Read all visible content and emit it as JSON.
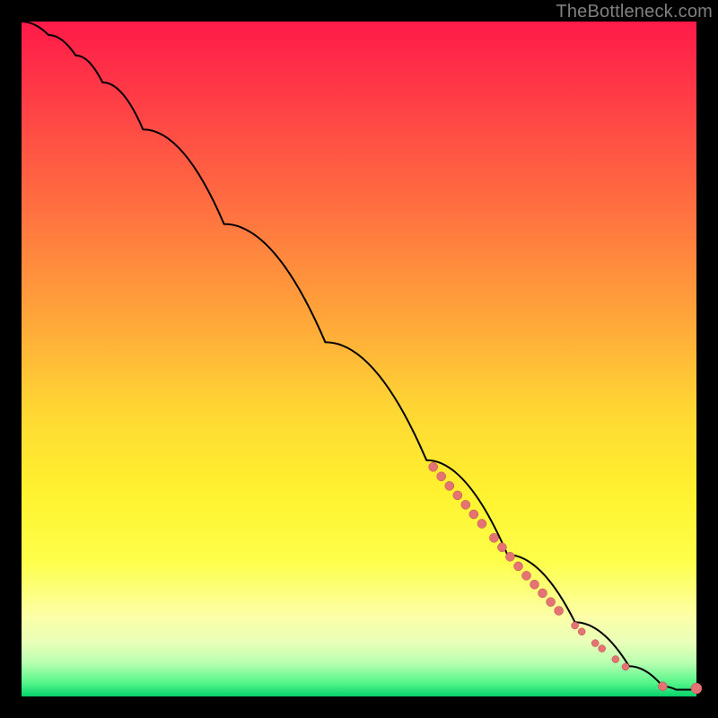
{
  "watermark": "TheBottleneck.com",
  "colors": {
    "marker_fill": "#e57373",
    "marker_stroke": "#bb4a4a",
    "curve_stroke": "#000000"
  },
  "chart_data": {
    "type": "line",
    "title": "",
    "xlabel": "",
    "ylabel": "",
    "xlim": [
      0,
      100
    ],
    "ylim": [
      0,
      100
    ],
    "curve": [
      {
        "x": 0,
        "y": 100
      },
      {
        "x": 4,
        "y": 98
      },
      {
        "x": 8,
        "y": 95
      },
      {
        "x": 12,
        "y": 91
      },
      {
        "x": 18,
        "y": 84
      },
      {
        "x": 30,
        "y": 70
      },
      {
        "x": 45,
        "y": 52.5
      },
      {
        "x": 60,
        "y": 35
      },
      {
        "x": 72,
        "y": 21
      },
      {
        "x": 82,
        "y": 11
      },
      {
        "x": 90,
        "y": 4.5
      },
      {
        "x": 95,
        "y": 1.5
      },
      {
        "x": 97,
        "y": 1.0
      },
      {
        "x": 100,
        "y": 1.0
      }
    ],
    "markers": [
      {
        "x": 61.0,
        "y": 34.0,
        "r": 5
      },
      {
        "x": 62.2,
        "y": 32.6,
        "r": 5
      },
      {
        "x": 63.4,
        "y": 31.2,
        "r": 5
      },
      {
        "x": 64.6,
        "y": 29.8,
        "r": 5
      },
      {
        "x": 65.8,
        "y": 28.4,
        "r": 5
      },
      {
        "x": 67.0,
        "y": 27.0,
        "r": 5
      },
      {
        "x": 68.2,
        "y": 25.6,
        "r": 5
      },
      {
        "x": 70.0,
        "y": 23.5,
        "r": 5
      },
      {
        "x": 71.2,
        "y": 22.1,
        "r": 5
      },
      {
        "x": 72.4,
        "y": 20.7,
        "r": 5
      },
      {
        "x": 73.6,
        "y": 19.3,
        "r": 5
      },
      {
        "x": 74.8,
        "y": 17.9,
        "r": 5
      },
      {
        "x": 76.0,
        "y": 16.6,
        "r": 5
      },
      {
        "x": 77.2,
        "y": 15.3,
        "r": 5
      },
      {
        "x": 78.4,
        "y": 14.0,
        "r": 5
      },
      {
        "x": 79.6,
        "y": 12.7,
        "r": 5
      },
      {
        "x": 82.0,
        "y": 10.5,
        "r": 4
      },
      {
        "x": 83.0,
        "y": 9.6,
        "r": 4
      },
      {
        "x": 85.0,
        "y": 7.9,
        "r": 4
      },
      {
        "x": 86.0,
        "y": 7.1,
        "r": 4
      },
      {
        "x": 88.0,
        "y": 5.5,
        "r": 4
      },
      {
        "x": 89.5,
        "y": 4.4,
        "r": 4
      },
      {
        "x": 95.0,
        "y": 1.5,
        "r": 5
      },
      {
        "x": 100.0,
        "y": 1.2,
        "r": 6
      }
    ]
  }
}
